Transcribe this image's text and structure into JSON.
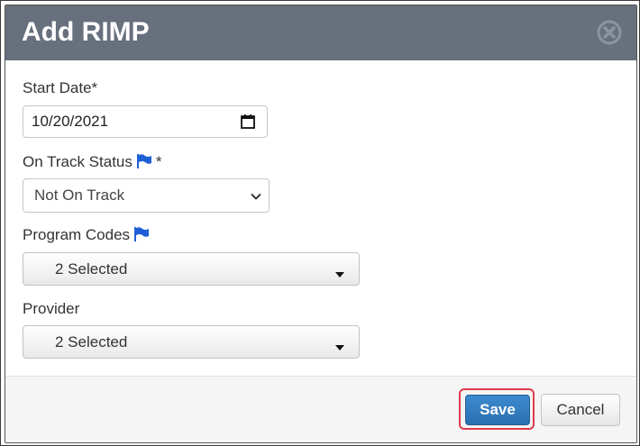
{
  "dialog": {
    "title": "Add RIMP",
    "close_icon": "close-circle-icon"
  },
  "form": {
    "start_date": {
      "label": "Start Date*",
      "value": "10/20/2021",
      "icon": "calendar-icon"
    },
    "on_track_status": {
      "label": "On Track Status",
      "required_mark": "*",
      "flag_icon": "flag-icon",
      "selected": "Not On Track",
      "icon": "chevron-down-icon"
    },
    "program_codes": {
      "label": "Program Codes",
      "flag_icon": "flag-icon",
      "selected": "2 Selected",
      "icon": "caret-down-icon"
    },
    "provider": {
      "label": "Provider",
      "selected": "2 Selected",
      "icon": "caret-down-icon"
    }
  },
  "footer": {
    "save_label": "Save",
    "cancel_label": "Cancel"
  },
  "colors": {
    "titlebar": "#67707c",
    "primary": "#2f7bc0",
    "highlight": "#e03a4a",
    "flag": "#1f5fd6"
  }
}
